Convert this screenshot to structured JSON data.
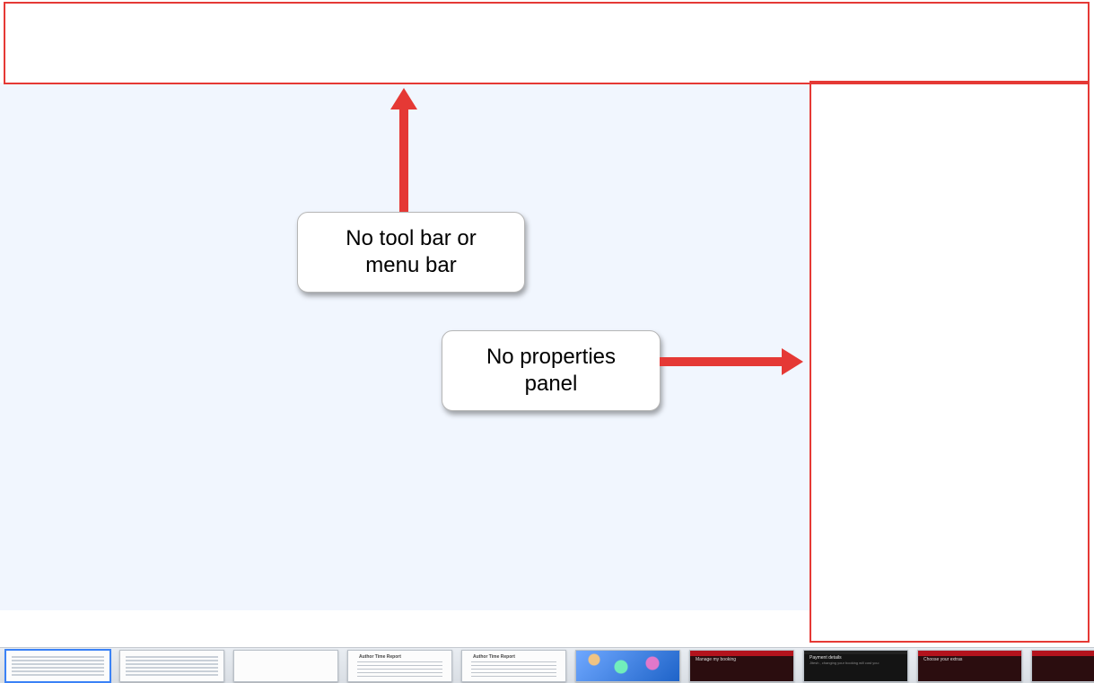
{
  "colors": {
    "highlight_border": "#e53935",
    "arrow": "#e53935",
    "canvas_bg": "#f1f6fe"
  },
  "frames": {
    "top": {
      "label": "top-highlight-frame"
    },
    "right": {
      "label": "right-highlight-frame"
    }
  },
  "callouts": {
    "toolbar": {
      "text": "No tool bar or\nmenu bar"
    },
    "properties": {
      "text": "No properties\npanel"
    }
  },
  "thumbnails": [
    {
      "kind": "bars",
      "selected": true
    },
    {
      "kind": "bars",
      "selected": false
    },
    {
      "kind": "blank",
      "selected": false
    },
    {
      "kind": "doc",
      "selected": false,
      "header": "Author Time Report"
    },
    {
      "kind": "doc",
      "selected": false,
      "header": "Author Time Report"
    },
    {
      "kind": "photo",
      "selected": false
    },
    {
      "kind": "dark",
      "selected": false,
      "title": "Manage my booking"
    },
    {
      "kind": "dark2",
      "selected": false,
      "title": "Payment details",
      "sub": "Jitesh , changing your booking will cost you:"
    },
    {
      "kind": "dark",
      "selected": false,
      "title": "Choose your extras"
    },
    {
      "kind": "dark",
      "selected": false,
      "title": ""
    }
  ]
}
